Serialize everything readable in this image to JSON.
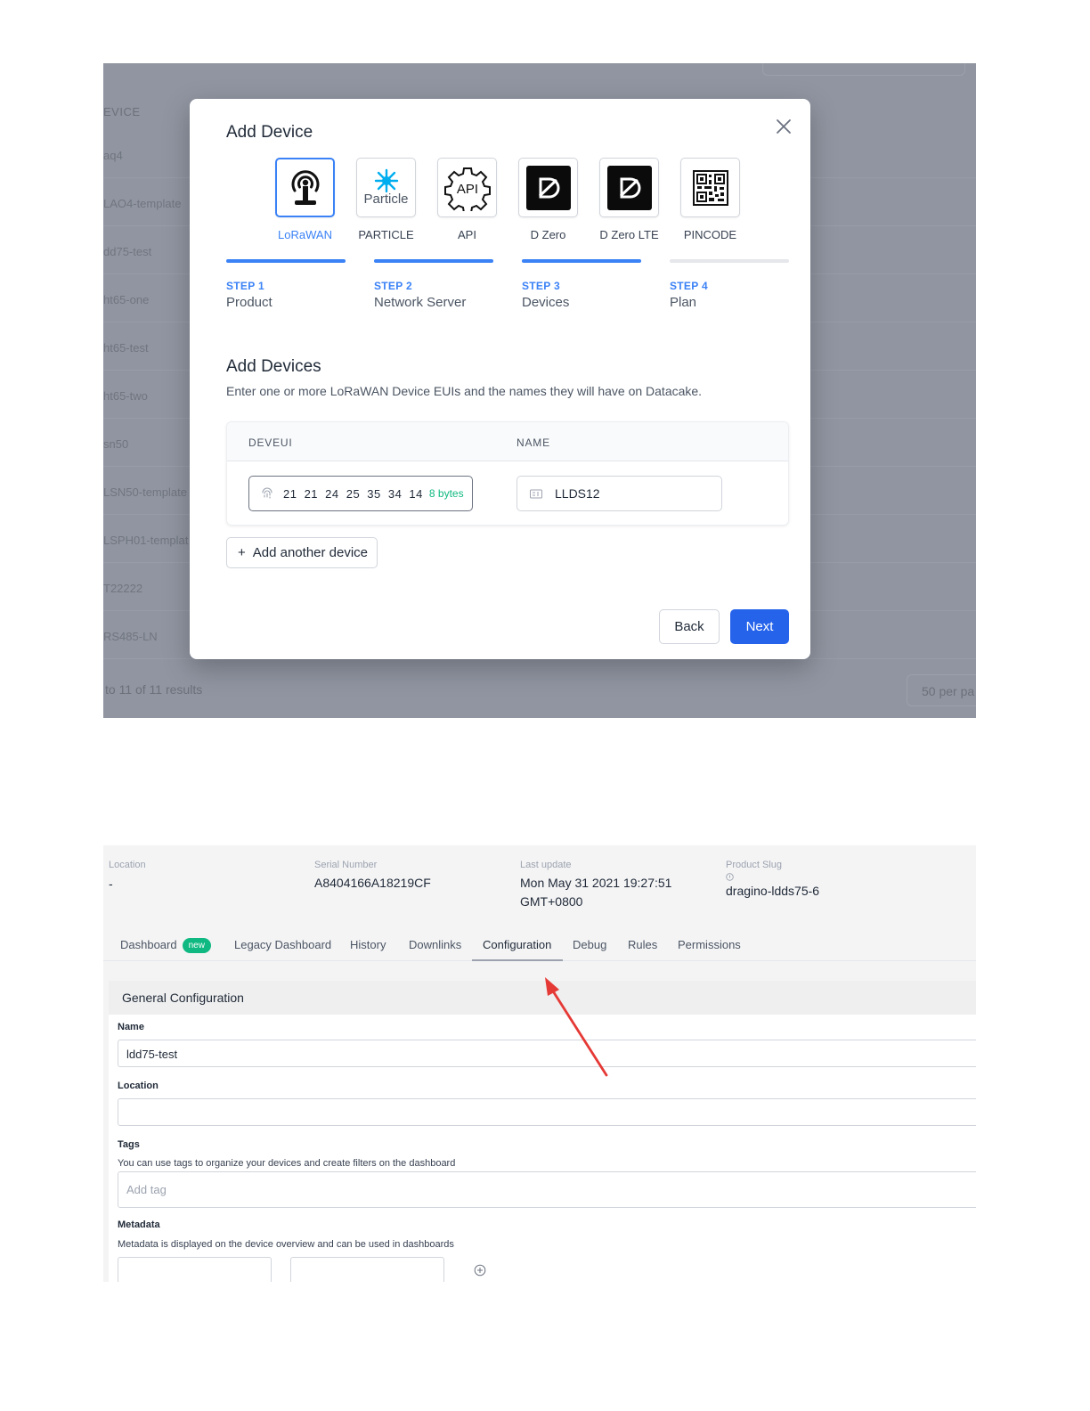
{
  "add_device_screen": {
    "background_list": {
      "header": "EVICE",
      "rows": [
        "aq4",
        "LAO4-template",
        "dd75-test",
        "ht65-one",
        "ht65-test",
        "ht65-two",
        "sn50",
        "LSN50-template",
        "LSPH01-templat",
        "T22222",
        "RS485-LN"
      ],
      "footer_text": "to 11 of 11 results",
      "per_page": "50 per pa"
    },
    "modal": {
      "title": "Add Device",
      "products": [
        {
          "label": "LoRaWAN",
          "icon": "antenna-icon",
          "selected": true
        },
        {
          "label": "PARTICLE",
          "icon": "particle-logo-icon",
          "logo_text": "Particle",
          "selected": false
        },
        {
          "label": "API",
          "icon": "api-gear-icon",
          "logo_text": "API",
          "selected": false
        },
        {
          "label": "D Zero",
          "icon": "dzero-logo-icon",
          "selected": false
        },
        {
          "label": "D Zero LTE",
          "icon": "dzero-lte-logo-icon",
          "selected": false
        },
        {
          "label": "PINCODE",
          "icon": "qr-code-icon",
          "selected": false
        }
      ],
      "steps": [
        {
          "number": "STEP 1",
          "name": "Product",
          "complete": true
        },
        {
          "number": "STEP 2",
          "name": "Network Server",
          "complete": true
        },
        {
          "number": "STEP 3",
          "name": "Devices",
          "complete": true
        },
        {
          "number": "STEP 4",
          "name": "Plan",
          "complete": false
        }
      ],
      "section_title": "Add Devices",
      "section_description": "Enter one or more LoRaWAN Device EUIs and the names they will have on Datacake.",
      "table": {
        "col_deveui": "DEVEUI",
        "col_name": "NAME",
        "deveui_value": "21 21 24 25 35 34 14",
        "deveui_bytes": "8 bytes",
        "name_value": "LLDS12"
      },
      "add_another_label": "Add another device",
      "back_label": "Back",
      "next_label": "Next",
      "accent_color": "#2563eb"
    }
  },
  "configuration_screen": {
    "meta": {
      "location_label": "Location",
      "location_value": "-",
      "serial_label": "Serial Number",
      "serial_value": "A8404166A18219CF",
      "last_update_label": "Last update",
      "last_update_line1": "Mon May 31 2021 19:27:51",
      "last_update_line2": "GMT+0800",
      "slug_label": "Product Slug",
      "slug_value": "dragino-ldds75-6"
    },
    "tabs": [
      {
        "label": "Dashboard",
        "badge": "new"
      },
      {
        "label": "Legacy Dashboard"
      },
      {
        "label": "History"
      },
      {
        "label": "Downlinks"
      },
      {
        "label": "Configuration",
        "active": true
      },
      {
        "label": "Debug"
      },
      {
        "label": "Rules"
      },
      {
        "label": "Permissions"
      }
    ],
    "general_config": {
      "title": "General Configuration",
      "name_label": "Name",
      "name_value": "ldd75-test",
      "location_label": "Location",
      "location_value": "",
      "tags_label": "Tags",
      "tags_help": "You can use tags to organize your devices and create filters on the dashboard",
      "tags_placeholder": "Add tag",
      "metadata_label": "Metadata",
      "metadata_help": "Metadata is displayed on the device overview and can be used in dashboards"
    },
    "annotation_color": "#e53935"
  }
}
